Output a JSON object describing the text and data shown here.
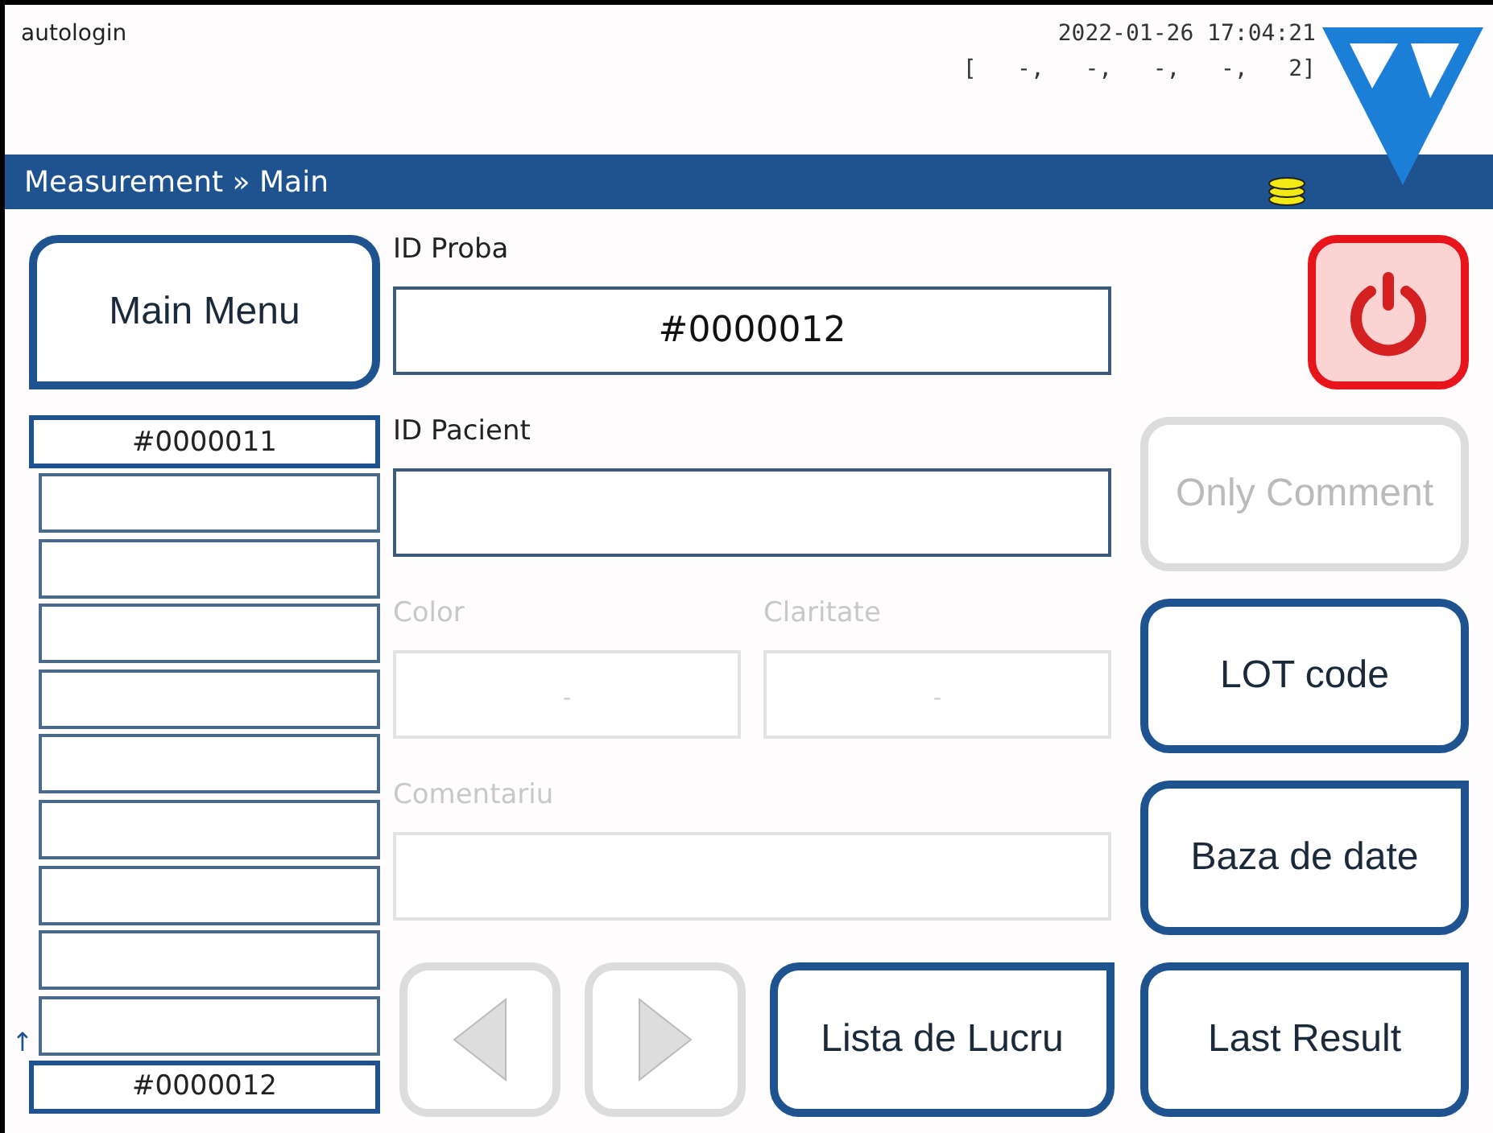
{
  "header": {
    "user": "autologin",
    "datetime": "2022-01-26 17:04:21",
    "status_line": "[   -,   -,   -,   -,   2]"
  },
  "breadcrumb": "Measurement » Main",
  "main_menu": {
    "label": "Main Menu",
    "marked": true
  },
  "queue": {
    "previous": "#0000011",
    "slots": [
      {
        "kind": "empty"
      },
      {
        "kind": "empty"
      },
      {
        "kind": "empty"
      },
      {
        "kind": "empty"
      },
      {
        "kind": "empty"
      },
      {
        "kind": "empty"
      },
      {
        "kind": "empty"
      },
      {
        "kind": "empty"
      },
      {
        "kind": "empty",
        "mark": "↑"
      }
    ],
    "current": "#0000012"
  },
  "fields": [
    {
      "label": "ID Proba",
      "value": "#0000012",
      "disabled": false,
      "kind": "wide"
    },
    {
      "label": "ID Pacient",
      "disabled": false,
      "kind": "wide"
    },
    {
      "label": "Color",
      "placeholder": "-",
      "disabled": true,
      "kind": "half"
    },
    {
      "label": "Claritate",
      "placeholder": "-",
      "disabled": true,
      "kind": "half"
    },
    {
      "label": "Comentariu",
      "disabled": true,
      "kind": "wide"
    }
  ],
  "bottom_buttons": [
    {
      "kind": "prev",
      "disabled": true
    },
    {
      "kind": "next",
      "disabled": true
    },
    {
      "kind": "text",
      "label": "Lista de Lucru",
      "disabled": false,
      "marked": true
    }
  ],
  "side_buttons": [
    {
      "kind": "power",
      "disabled": false
    },
    {
      "kind": "text",
      "label": "Only Comment",
      "disabled": true,
      "marked": false
    },
    {
      "kind": "text",
      "label": "LOT code",
      "disabled": false,
      "marked": false
    },
    {
      "kind": "text",
      "label": "Baza de date",
      "disabled": false,
      "marked": true
    },
    {
      "kind": "text",
      "label": "Last Result",
      "disabled": false,
      "marked": true
    }
  ]
}
